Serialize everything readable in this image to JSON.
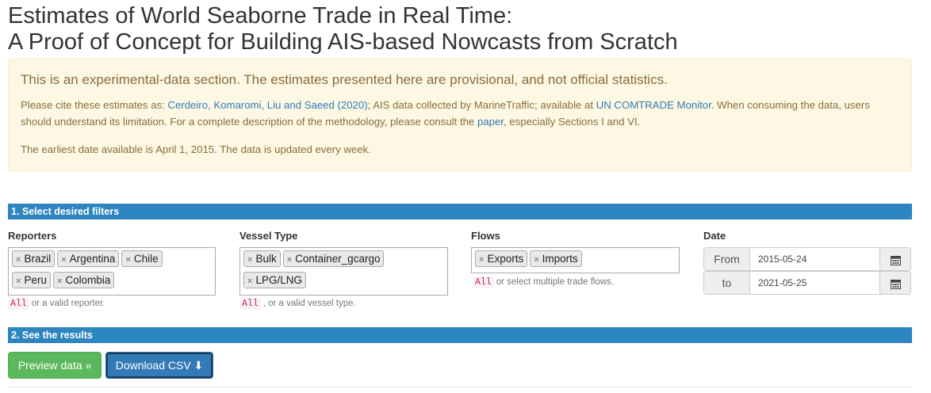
{
  "page": {
    "title_line1": "Estimates of World Seaborne Trade in Real Time:",
    "title_line2": "A Proof of Concept for Building AIS-based Nowcasts from Scratch"
  },
  "notice": {
    "lead": "This is an experimental-data section. The estimates presented here are provisional, and not official statistics.",
    "cite_prefix": "Please cite these estimates as: ",
    "cite_authors_link": "Cerdeiro, Komaromi, Liu and Saeed (2020)",
    "cite_middle": "; AIS data collected by MarineTraffic; available at ",
    "comtrade_link": "UN COMTRADE Monitor",
    "cite_suffix": ". When consuming the data, users should understand its limitation. For a complete description of the methodology, please consult the ",
    "paper_link": "paper",
    "cite_end": ", especially Sections I and VI.",
    "earliest": "The earliest date available is April 1, 2015. The data is updated every week."
  },
  "section1": {
    "label": "1. Select desired filters"
  },
  "filters": {
    "reporters": {
      "label": "Reporters",
      "tags": [
        "Brazil",
        "Argentina",
        "Chile",
        "Peru",
        "Colombia"
      ],
      "hint_code": "All",
      "hint_text": "or a valid reporter."
    },
    "vessel_type": {
      "label": "Vessel Type",
      "tags": [
        "Bulk",
        "Container_gcargo",
        "LPG/LNG"
      ],
      "hint_code": "All",
      "hint_text": ", or a valid vessel type."
    },
    "flows": {
      "label": "Flows",
      "tags": [
        "Exports",
        "Imports"
      ],
      "hint_code": "All",
      "hint_text": "or select multiple trade flows."
    },
    "date": {
      "label": "Date",
      "from_label": "From",
      "from_value": "2015-05-24",
      "to_label": "to",
      "to_value": "2021-05-25"
    }
  },
  "section2": {
    "label": "2. See the results"
  },
  "actions": {
    "preview_label": "Preview data »",
    "download_label": "Download CSV ⬇"
  },
  "icons": {
    "remove_tag": "×",
    "calendar": "calendar-icon"
  },
  "colors": {
    "section_bar": "#2e86c1",
    "warning_bg": "#fcf8e3",
    "warning_text": "#8a6d3b",
    "preview_btn": "#5cb85c",
    "download_btn": "#337ab7",
    "link": "#337ab7"
  }
}
